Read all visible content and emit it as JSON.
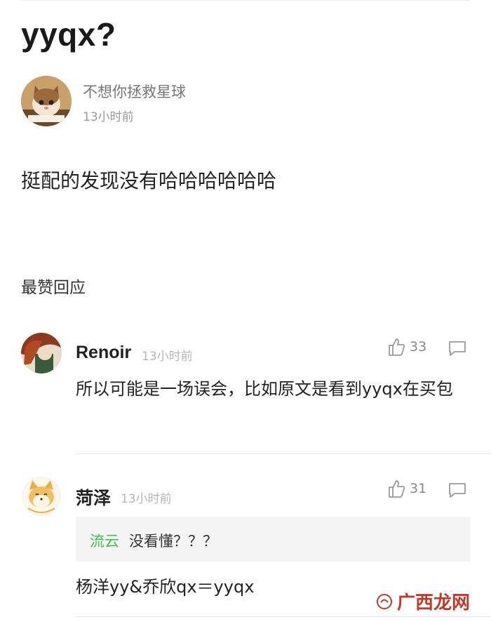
{
  "post": {
    "title": "yyqx?",
    "author": "不想你拯救星球",
    "time": "13小时前",
    "body": "挺配的发现没有哈哈哈哈哈哈"
  },
  "section_label": "最赞回应",
  "comments": [
    {
      "name": "Renoir",
      "time": "13小时前",
      "likes": "33",
      "text": "所以可能是一场误会，比如原文是看到yyqx在买包"
    },
    {
      "name": "菏泽",
      "time": "13小时前",
      "likes": "31",
      "quote_author": "流云",
      "quote_text": "没看懂？？？",
      "text": "杨洋yy&乔欣qx＝yyqx"
    }
  ],
  "watermark": {
    "text": "广西龙网"
  },
  "colors": {
    "quote_author": "#42bd56",
    "watermark": "#c0392b"
  }
}
